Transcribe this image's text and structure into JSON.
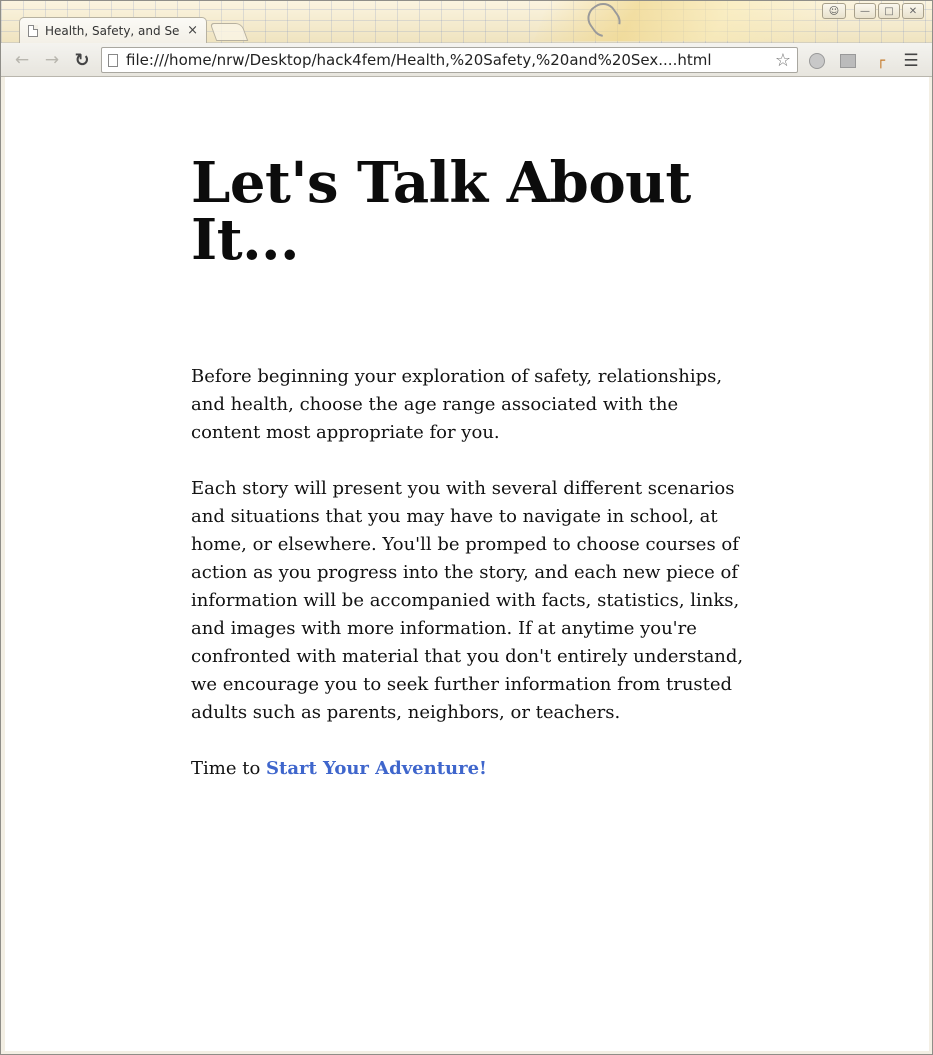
{
  "browser": {
    "tab_title": "Health, Safety, and Se",
    "tab_close": "×",
    "url": "file:///home/nrw/Desktop/hack4fem/Health,%20Safety,%20and%20Sex....html",
    "icons": {
      "back": "back-arrow-icon",
      "forward": "forward-arrow-icon",
      "reload": "reload-icon",
      "star": "bookmark-star-icon",
      "menu": "hamburger-menu-icon"
    }
  },
  "page": {
    "heading": "Let's Talk About It...",
    "paragraph1": "Before beginning your exploration of safety, relationships, and health, choose the age range associated with the content most appropriate for you.",
    "paragraph2": "Each story will present you with several different scenarios and situations that you may have to navigate in school, at home, or elsewhere. You'll be promped to choose courses of action as you progress into the story, and each new piece of information will be accompanied with facts, statistics, links, and images with more information. If at anytime you're confronted with material that you don't entirely understand, we encourage you to seek further information from trusted adults such as parents, neighbors, or teachers.",
    "cta_prefix": "Time to ",
    "cta_link": "Start Your Adventure!",
    "link_color": "#3f66cc"
  }
}
